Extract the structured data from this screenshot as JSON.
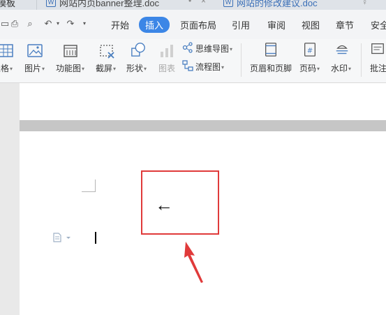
{
  "tabs": [
    {
      "label": "模板"
    },
    {
      "label": "网站内页banner整理.doc"
    },
    {
      "label": "网站的修改建议.doc"
    }
  ],
  "menu": {
    "start": "开始",
    "insert": "插入",
    "page_layout": "页面布局",
    "references": "引用",
    "review": "审阅",
    "view": "视图",
    "chapter": "章节",
    "security": "安全"
  },
  "ribbon": {
    "table": "表格",
    "picture": "图片",
    "function_chart": "功能图",
    "screenshot": "截屏",
    "shape": "形状",
    "chart": "图表",
    "mind_map": "思维导图",
    "flowchart": "流程图",
    "header_footer": "页眉和页脚",
    "page_number": "页码",
    "watermark": "水印",
    "comment": "批注"
  },
  "document": {
    "arrow_symbol": "←"
  },
  "colors": {
    "accent": "#3c86e6",
    "highlight": "#e03a3a"
  }
}
